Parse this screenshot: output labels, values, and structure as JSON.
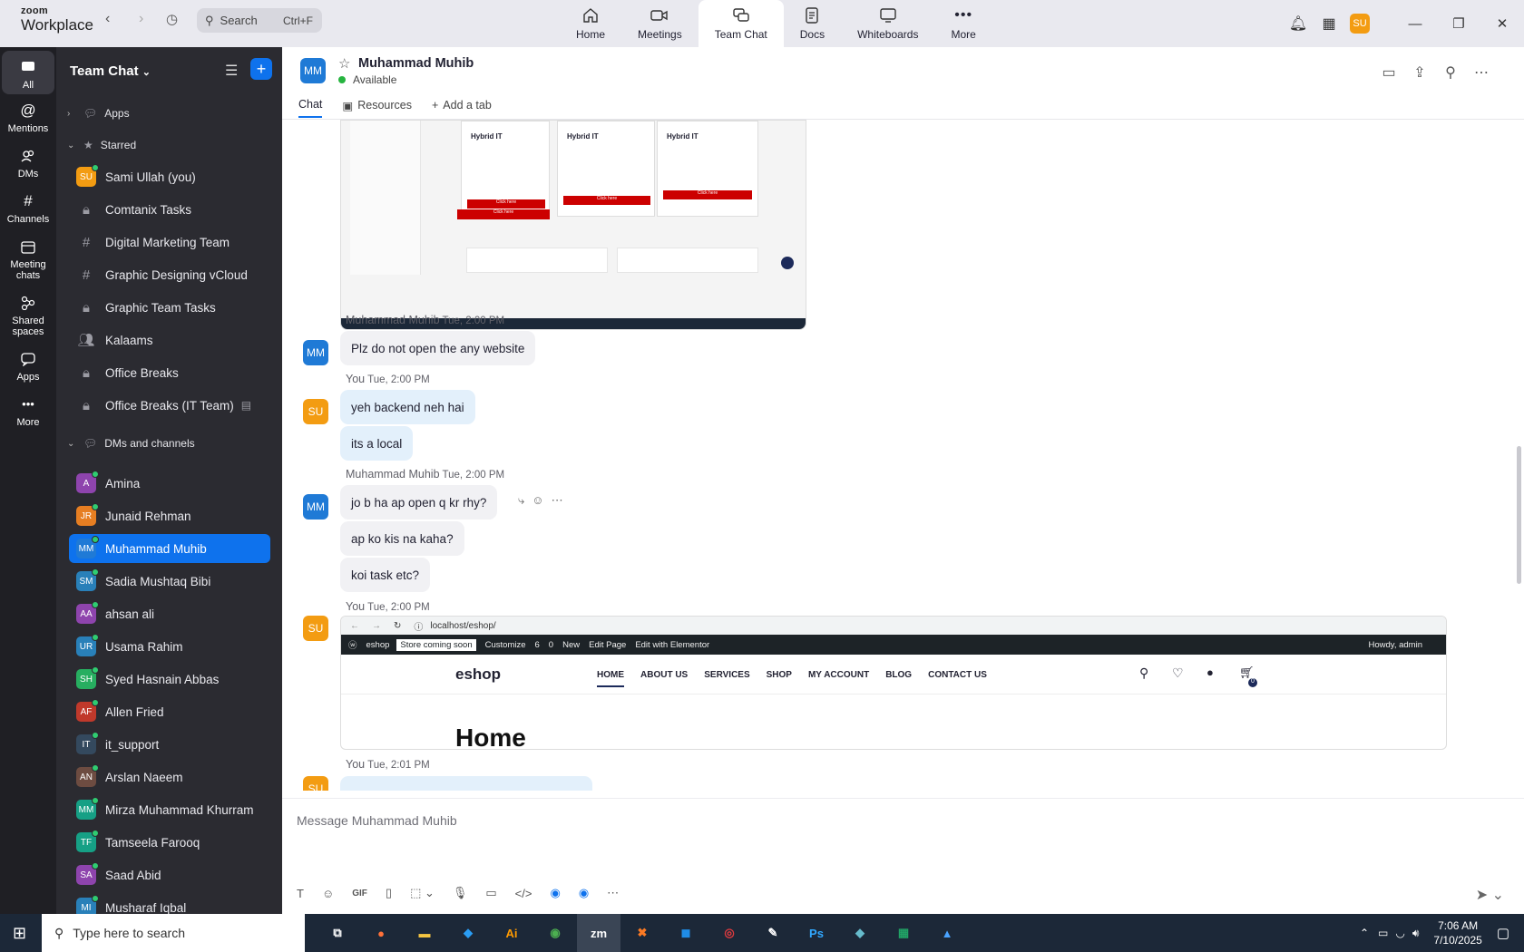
{
  "app": {
    "brand_top": "zoom",
    "brand_bottom": "Workplace"
  },
  "search": {
    "label": "Search",
    "shortcut": "Ctrl+F"
  },
  "top_tabs": [
    {
      "label": "Home",
      "icon": "home-icon"
    },
    {
      "label": "Meetings",
      "icon": "video-icon"
    },
    {
      "label": "Team Chat",
      "icon": "chat-icon"
    },
    {
      "label": "Docs",
      "icon": "doc-icon"
    },
    {
      "label": "Whiteboards",
      "icon": "whiteboard-icon"
    },
    {
      "label": "More",
      "icon": "more-icon"
    }
  ],
  "user_avatar": "SU",
  "rail": [
    {
      "label": "All",
      "icon": "chat-bubble-icon"
    },
    {
      "label": "Mentions",
      "icon": "at-icon"
    },
    {
      "label": "DMs",
      "icon": "people-icon"
    },
    {
      "label": "Channels",
      "icon": "hash-icon"
    },
    {
      "label": "Meeting chats",
      "icon": "calendar-icon"
    },
    {
      "label": "Shared spaces",
      "icon": "share-icon"
    },
    {
      "label": "Apps",
      "icon": "apps-icon"
    },
    {
      "label": "More",
      "icon": "dots-icon"
    }
  ],
  "sidebar": {
    "title": "Team Chat",
    "apps_label": "Apps",
    "starred_label": "Starred",
    "dms_label": "DMs and channels",
    "starred": [
      {
        "initials": "SU",
        "name": "Sami Ullah (you)",
        "color": "#f39c12",
        "type": "avatar"
      },
      {
        "name": "Comtanix Tasks",
        "type": "lock"
      },
      {
        "name": "Digital Marketing Team",
        "type": "hash"
      },
      {
        "name": "Graphic Designing vCloud",
        "type": "hash"
      },
      {
        "name": "Graphic Team Tasks",
        "type": "lock"
      },
      {
        "name": "Kalaams",
        "type": "group"
      },
      {
        "name": "Office Breaks",
        "type": "lock"
      },
      {
        "name": "Office Breaks (IT Team)",
        "type": "lock"
      }
    ],
    "dms": [
      {
        "initials": "A",
        "name": "Amina",
        "color": "#8e44ad"
      },
      {
        "initials": "JR",
        "name": "Junaid Rehman",
        "color": "#e67e22"
      },
      {
        "initials": "MM",
        "name": "Muhammad Muhib",
        "color": "#1f7ad6"
      },
      {
        "initials": "SM",
        "name": "Sadia Mushtaq Bibi",
        "color": "#2980b9"
      },
      {
        "initials": "AA",
        "name": "ahsan ali",
        "color": "#8e44ad"
      },
      {
        "initials": "UR",
        "name": "Usama Rahim",
        "color": "#2980b9"
      },
      {
        "initials": "SH",
        "name": "Syed Hasnain Abbas",
        "color": "#27ae60"
      },
      {
        "initials": "AF",
        "name": "Allen Fried",
        "color": "#c0392b"
      },
      {
        "initials": "IT",
        "name": "it_support",
        "color": "#34495e"
      },
      {
        "initials": "AN",
        "name": "Arslan Naeem",
        "color": "#6d4c41"
      },
      {
        "initials": "MM",
        "name": "Mirza Muhammad Khurram",
        "color": "#16a085"
      },
      {
        "initials": "TF",
        "name": "Tamseela Farooq",
        "color": "#16a085"
      },
      {
        "initials": "SA",
        "name": "Saad Abid",
        "color": "#8e44ad"
      },
      {
        "initials": "MI",
        "name": "Musharaf Iqbal",
        "color": "#2980b9"
      }
    ]
  },
  "chat": {
    "contact_initials": "MM",
    "contact_name": "Muhammad Muhib",
    "status": "Available",
    "tabs": [
      "Chat",
      "Resources",
      "Add a tab"
    ],
    "messages": [
      {
        "sender": "Muhammad Muhib",
        "time": "Tue, 2:00 PM",
        "texts": [
          "Plz do not open the any website"
        ]
      },
      {
        "sender": "You",
        "time": "Tue, 2:00 PM",
        "texts": [
          "yeh backend neh hai",
          "its a local"
        ]
      },
      {
        "sender": "Muhammad Muhib",
        "time": "Tue, 2:00 PM",
        "texts": [
          "jo b ha ap open q kr rhy?",
          "ap ko kis na kaha?",
          "koi task etc?"
        ]
      },
      {
        "sender": "You",
        "time": "Tue, 2:00 PM",
        "texts": []
      },
      {
        "sender": "You",
        "time": "Tue, 2:01 PM",
        "texts": []
      }
    ],
    "composer_placeholder": "Message Muhammad Muhib"
  },
  "screenshot1": {
    "card_title": "Hybrid IT",
    "button": "Click here"
  },
  "screenshot2": {
    "url": "localhost/eshop/",
    "admin_items": [
      "eshop",
      "Store coming soon",
      "Customize",
      "6",
      "0",
      "New",
      "Edit Page",
      "Edit with Elementor"
    ],
    "howdy": "Howdy, admin",
    "site_title": "eshop",
    "menu": [
      "HOME",
      "ABOUT US",
      "SERVICES",
      "SHOP",
      "MY ACCOUNT",
      "BLOG",
      "CONTACT US"
    ],
    "cart_count": "0",
    "page_heading": "Home"
  },
  "taskbar": {
    "search": "Type here to search",
    "time": "7:06 AM",
    "date": "7/10/2025",
    "apps": [
      "Ai",
      "zm",
      "Ps"
    ]
  }
}
